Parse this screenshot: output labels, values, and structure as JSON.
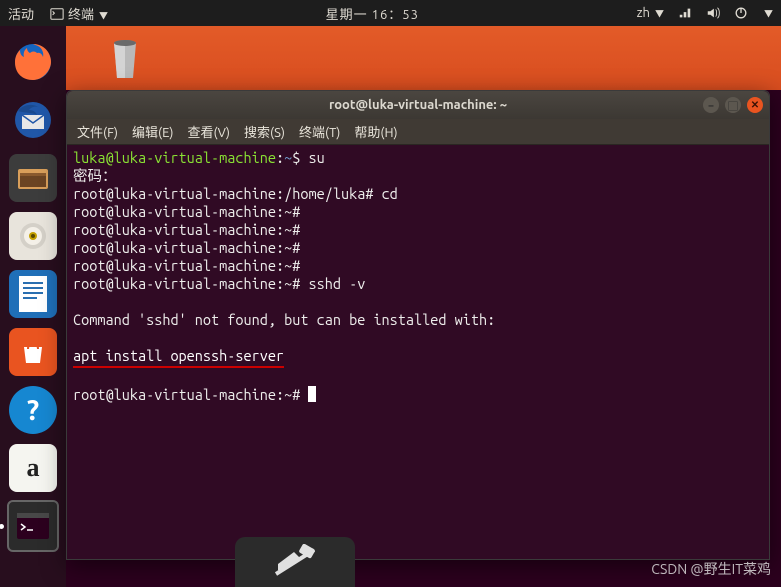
{
  "top_panel": {
    "activities": "活动",
    "app_name": "终端",
    "clock": "星期一 16：53",
    "input_method": "zh",
    "icons": {
      "network": "network-icon",
      "volume": "volume-icon",
      "power": "power-icon"
    }
  },
  "launcher": {
    "items": [
      {
        "name": "firefox"
      },
      {
        "name": "thunderbird"
      },
      {
        "name": "files"
      },
      {
        "name": "rhythmbox"
      },
      {
        "name": "libreoffice-writer"
      },
      {
        "name": "ubuntu-software"
      },
      {
        "name": "help"
      },
      {
        "name": "amazon"
      },
      {
        "name": "terminal"
      }
    ]
  },
  "terminal_window": {
    "title": "root@luka-virtual-machine: ~",
    "menu": {
      "file": "文件(F)",
      "edit": "编辑(E)",
      "view": "查看(V)",
      "search": "搜索(S)",
      "terminal": "终端(T)",
      "help": "帮助(H)"
    },
    "lines": {
      "l1_user": "luka@luka-virtual-machine",
      "l1_sep": ":",
      "l1_path": "~",
      "l1_cmd": "$ su",
      "l2": "密码：",
      "l3_prompt": "root@luka-virtual-machine:/home/luka# ",
      "l3_cmd": "cd",
      "l4": "root@luka-virtual-machine:~# ",
      "l5": "root@luka-virtual-machine:~# ",
      "l6": "root@luka-virtual-machine:~# ",
      "l7": "root@luka-virtual-machine:~# ",
      "l8_prompt": "root@luka-virtual-machine:~# ",
      "l8_cmd": "sshd -v",
      "l10": "Command 'sshd' not found, but can be installed with:",
      "l12": "apt install openssh-server",
      "l14": "root@luka-virtual-machine:~# "
    }
  },
  "watermark": "CSDN @野生IT菜鸡"
}
